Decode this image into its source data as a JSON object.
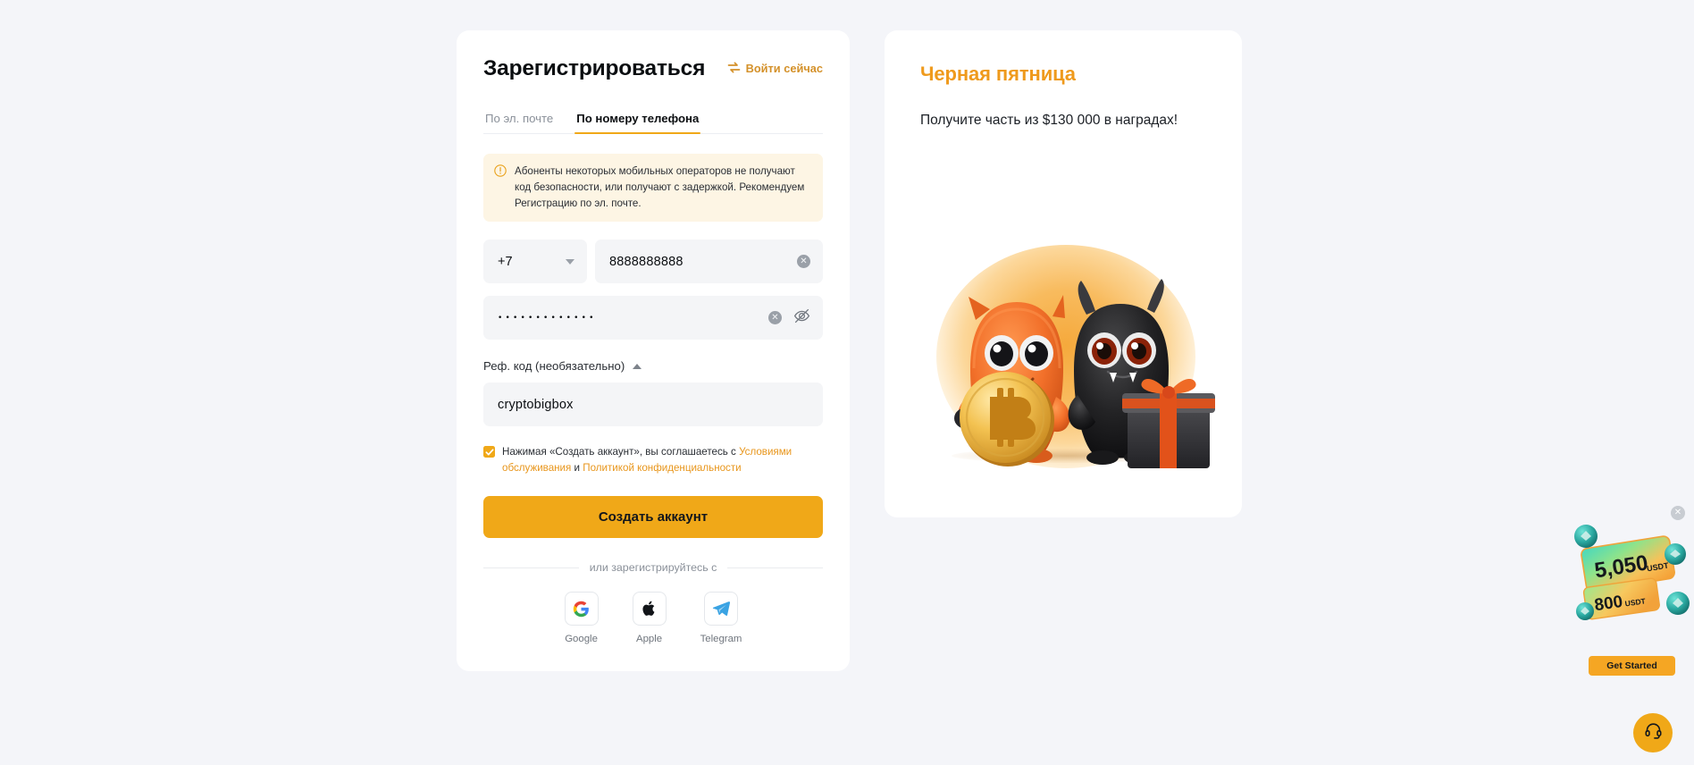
{
  "theme": {
    "page_bg": "#f4f5f9",
    "card_bg": "#ffffff",
    "accent": "#f0a818",
    "accent_text": "#d4912a",
    "promo_title_color": "#ef9a1c",
    "alert_bg": "#fdf5e4",
    "input_bg": "#f4f5f7",
    "muted_text": "#8a9099"
  },
  "register": {
    "title": "Зарегистрироваться",
    "login_link": "Войти сейчас",
    "login_icon": "swap-arrows-icon",
    "tabs": [
      {
        "label": "По эл. почте",
        "active": false
      },
      {
        "label": "По номеру телефона",
        "active": true
      }
    ],
    "alert": {
      "icon": "warning-circle-icon",
      "text": "Абоненты некоторых мобильных операторов не получают код безопасности, или получают с задержкой. Рекомендуем Регистрацию по эл. почте."
    },
    "country_code": {
      "value": "+7",
      "icon": "chevron-down-icon"
    },
    "phone": {
      "value": "8888888888",
      "placeholder": "",
      "clear_icon": "clear-circle-icon"
    },
    "password": {
      "value": "•••••••••••••",
      "placeholder": "",
      "clear_icon": "clear-circle-icon",
      "toggle_icon": "eye-off-icon"
    },
    "referral": {
      "label": "Реф. код (необязательно)",
      "toggle_icon": "chevron-up-icon",
      "value": "cryptobigbox",
      "placeholder": ""
    },
    "terms": {
      "checked": true,
      "prefix": "Нажимая «Создать аккаунт», вы соглашаетесь с ",
      "link1": "Условиями обслуживания",
      "middle": " и ",
      "link2": "Политикой конфиденциальности"
    },
    "submit_label": "Создать аккаунт",
    "divider_text": "или зарегистрируйтесь с",
    "socials": [
      {
        "label": "Google",
        "icon": "google-icon"
      },
      {
        "label": "Apple",
        "icon": "apple-icon"
      },
      {
        "label": "Telegram",
        "icon": "telegram-icon"
      }
    ]
  },
  "promo": {
    "title": "Черная пятница",
    "subtitle": "Получите часть из $130 000 в наградах!",
    "illustration": "two-monsters-bitcoin-gift-illustration"
  },
  "floating_widget": {
    "close_icon": "close-icon",
    "voucher_primary_amount": "5,050",
    "voucher_primary_unit": "USDT",
    "voucher_secondary_amount": "800",
    "voucher_secondary_unit": "USDT",
    "cta_label": "Get Started"
  },
  "support": {
    "icon": "headset-icon",
    "label": ""
  }
}
